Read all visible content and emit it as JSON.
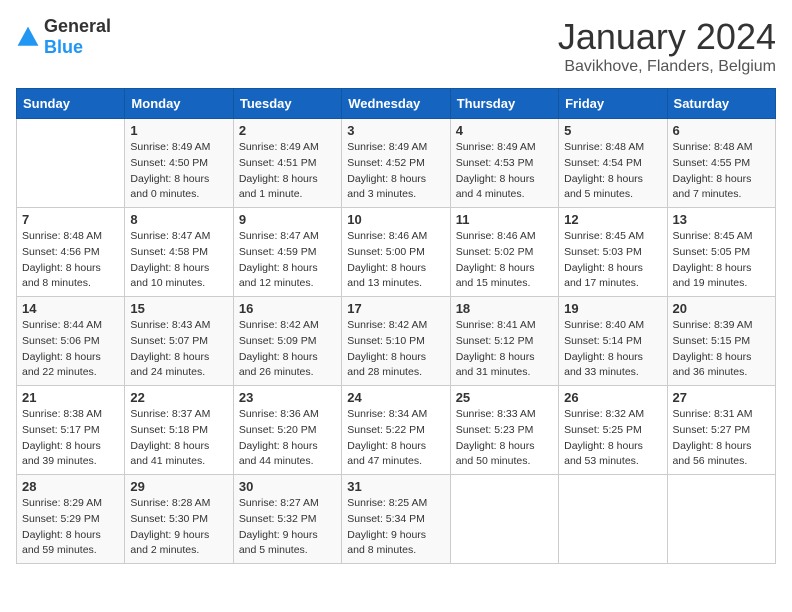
{
  "logo": {
    "general": "General",
    "blue": "Blue"
  },
  "title": "January 2024",
  "subtitle": "Bavikhove, Flanders, Belgium",
  "days_header": [
    "Sunday",
    "Monday",
    "Tuesday",
    "Wednesday",
    "Thursday",
    "Friday",
    "Saturday"
  ],
  "weeks": [
    [
      {
        "day": "",
        "sunrise": "",
        "sunset": "",
        "daylight": ""
      },
      {
        "day": "1",
        "sunrise": "Sunrise: 8:49 AM",
        "sunset": "Sunset: 4:50 PM",
        "daylight": "Daylight: 8 hours and 0 minutes."
      },
      {
        "day": "2",
        "sunrise": "Sunrise: 8:49 AM",
        "sunset": "Sunset: 4:51 PM",
        "daylight": "Daylight: 8 hours and 1 minute."
      },
      {
        "day": "3",
        "sunrise": "Sunrise: 8:49 AM",
        "sunset": "Sunset: 4:52 PM",
        "daylight": "Daylight: 8 hours and 3 minutes."
      },
      {
        "day": "4",
        "sunrise": "Sunrise: 8:49 AM",
        "sunset": "Sunset: 4:53 PM",
        "daylight": "Daylight: 8 hours and 4 minutes."
      },
      {
        "day": "5",
        "sunrise": "Sunrise: 8:48 AM",
        "sunset": "Sunset: 4:54 PM",
        "daylight": "Daylight: 8 hours and 5 minutes."
      },
      {
        "day": "6",
        "sunrise": "Sunrise: 8:48 AM",
        "sunset": "Sunset: 4:55 PM",
        "daylight": "Daylight: 8 hours and 7 minutes."
      }
    ],
    [
      {
        "day": "7",
        "sunrise": "Sunrise: 8:48 AM",
        "sunset": "Sunset: 4:56 PM",
        "daylight": "Daylight: 8 hours and 8 minutes."
      },
      {
        "day": "8",
        "sunrise": "Sunrise: 8:47 AM",
        "sunset": "Sunset: 4:58 PM",
        "daylight": "Daylight: 8 hours and 10 minutes."
      },
      {
        "day": "9",
        "sunrise": "Sunrise: 8:47 AM",
        "sunset": "Sunset: 4:59 PM",
        "daylight": "Daylight: 8 hours and 12 minutes."
      },
      {
        "day": "10",
        "sunrise": "Sunrise: 8:46 AM",
        "sunset": "Sunset: 5:00 PM",
        "daylight": "Daylight: 8 hours and 13 minutes."
      },
      {
        "day": "11",
        "sunrise": "Sunrise: 8:46 AM",
        "sunset": "Sunset: 5:02 PM",
        "daylight": "Daylight: 8 hours and 15 minutes."
      },
      {
        "day": "12",
        "sunrise": "Sunrise: 8:45 AM",
        "sunset": "Sunset: 5:03 PM",
        "daylight": "Daylight: 8 hours and 17 minutes."
      },
      {
        "day": "13",
        "sunrise": "Sunrise: 8:45 AM",
        "sunset": "Sunset: 5:05 PM",
        "daylight": "Daylight: 8 hours and 19 minutes."
      }
    ],
    [
      {
        "day": "14",
        "sunrise": "Sunrise: 8:44 AM",
        "sunset": "Sunset: 5:06 PM",
        "daylight": "Daylight: 8 hours and 22 minutes."
      },
      {
        "day": "15",
        "sunrise": "Sunrise: 8:43 AM",
        "sunset": "Sunset: 5:07 PM",
        "daylight": "Daylight: 8 hours and 24 minutes."
      },
      {
        "day": "16",
        "sunrise": "Sunrise: 8:42 AM",
        "sunset": "Sunset: 5:09 PM",
        "daylight": "Daylight: 8 hours and 26 minutes."
      },
      {
        "day": "17",
        "sunrise": "Sunrise: 8:42 AM",
        "sunset": "Sunset: 5:10 PM",
        "daylight": "Daylight: 8 hours and 28 minutes."
      },
      {
        "day": "18",
        "sunrise": "Sunrise: 8:41 AM",
        "sunset": "Sunset: 5:12 PM",
        "daylight": "Daylight: 8 hours and 31 minutes."
      },
      {
        "day": "19",
        "sunrise": "Sunrise: 8:40 AM",
        "sunset": "Sunset: 5:14 PM",
        "daylight": "Daylight: 8 hours and 33 minutes."
      },
      {
        "day": "20",
        "sunrise": "Sunrise: 8:39 AM",
        "sunset": "Sunset: 5:15 PM",
        "daylight": "Daylight: 8 hours and 36 minutes."
      }
    ],
    [
      {
        "day": "21",
        "sunrise": "Sunrise: 8:38 AM",
        "sunset": "Sunset: 5:17 PM",
        "daylight": "Daylight: 8 hours and 39 minutes."
      },
      {
        "day": "22",
        "sunrise": "Sunrise: 8:37 AM",
        "sunset": "Sunset: 5:18 PM",
        "daylight": "Daylight: 8 hours and 41 minutes."
      },
      {
        "day": "23",
        "sunrise": "Sunrise: 8:36 AM",
        "sunset": "Sunset: 5:20 PM",
        "daylight": "Daylight: 8 hours and 44 minutes."
      },
      {
        "day": "24",
        "sunrise": "Sunrise: 8:34 AM",
        "sunset": "Sunset: 5:22 PM",
        "daylight": "Daylight: 8 hours and 47 minutes."
      },
      {
        "day": "25",
        "sunrise": "Sunrise: 8:33 AM",
        "sunset": "Sunset: 5:23 PM",
        "daylight": "Daylight: 8 hours and 50 minutes."
      },
      {
        "day": "26",
        "sunrise": "Sunrise: 8:32 AM",
        "sunset": "Sunset: 5:25 PM",
        "daylight": "Daylight: 8 hours and 53 minutes."
      },
      {
        "day": "27",
        "sunrise": "Sunrise: 8:31 AM",
        "sunset": "Sunset: 5:27 PM",
        "daylight": "Daylight: 8 hours and 56 minutes."
      }
    ],
    [
      {
        "day": "28",
        "sunrise": "Sunrise: 8:29 AM",
        "sunset": "Sunset: 5:29 PM",
        "daylight": "Daylight: 8 hours and 59 minutes."
      },
      {
        "day": "29",
        "sunrise": "Sunrise: 8:28 AM",
        "sunset": "Sunset: 5:30 PM",
        "daylight": "Daylight: 9 hours and 2 minutes."
      },
      {
        "day": "30",
        "sunrise": "Sunrise: 8:27 AM",
        "sunset": "Sunset: 5:32 PM",
        "daylight": "Daylight: 9 hours and 5 minutes."
      },
      {
        "day": "31",
        "sunrise": "Sunrise: 8:25 AM",
        "sunset": "Sunset: 5:34 PM",
        "daylight": "Daylight: 9 hours and 8 minutes."
      },
      {
        "day": "",
        "sunrise": "",
        "sunset": "",
        "daylight": ""
      },
      {
        "day": "",
        "sunrise": "",
        "sunset": "",
        "daylight": ""
      },
      {
        "day": "",
        "sunrise": "",
        "sunset": "",
        "daylight": ""
      }
    ]
  ]
}
